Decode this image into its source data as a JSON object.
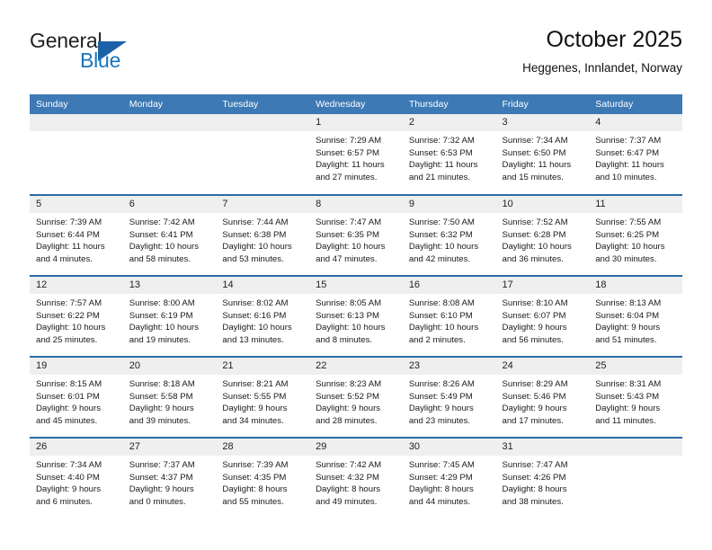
{
  "brand": {
    "name_top": "General",
    "name_bottom": "Blue",
    "color_dark": "#231f20",
    "color_blue": "#1b75bc",
    "triangle_color": "#1b61a8"
  },
  "header": {
    "title": "October 2025",
    "subtitle": "Heggenes, Innlandet, Norway"
  },
  "theme": {
    "header_blue": "#3d79b5",
    "row_divider_blue": "#2b6ca8",
    "daynum_band": "#efefef"
  },
  "weekday_headers": [
    "Sunday",
    "Monday",
    "Tuesday",
    "Wednesday",
    "Thursday",
    "Friday",
    "Saturday"
  ],
  "weeks": [
    [
      {
        "day": "",
        "sunrise": "",
        "sunset": "",
        "daylight_line1": "",
        "daylight_line2": ""
      },
      {
        "day": "",
        "sunrise": "",
        "sunset": "",
        "daylight_line1": "",
        "daylight_line2": ""
      },
      {
        "day": "",
        "sunrise": "",
        "sunset": "",
        "daylight_line1": "",
        "daylight_line2": ""
      },
      {
        "day": "1",
        "sunrise": "Sunrise: 7:29 AM",
        "sunset": "Sunset: 6:57 PM",
        "daylight_line1": "Daylight: 11 hours",
        "daylight_line2": "and 27 minutes."
      },
      {
        "day": "2",
        "sunrise": "Sunrise: 7:32 AM",
        "sunset": "Sunset: 6:53 PM",
        "daylight_line1": "Daylight: 11 hours",
        "daylight_line2": "and 21 minutes."
      },
      {
        "day": "3",
        "sunrise": "Sunrise: 7:34 AM",
        "sunset": "Sunset: 6:50 PM",
        "daylight_line1": "Daylight: 11 hours",
        "daylight_line2": "and 15 minutes."
      },
      {
        "day": "4",
        "sunrise": "Sunrise: 7:37 AM",
        "sunset": "Sunset: 6:47 PM",
        "daylight_line1": "Daylight: 11 hours",
        "daylight_line2": "and 10 minutes."
      }
    ],
    [
      {
        "day": "5",
        "sunrise": "Sunrise: 7:39 AM",
        "sunset": "Sunset: 6:44 PM",
        "daylight_line1": "Daylight: 11 hours",
        "daylight_line2": "and 4 minutes."
      },
      {
        "day": "6",
        "sunrise": "Sunrise: 7:42 AM",
        "sunset": "Sunset: 6:41 PM",
        "daylight_line1": "Daylight: 10 hours",
        "daylight_line2": "and 58 minutes."
      },
      {
        "day": "7",
        "sunrise": "Sunrise: 7:44 AM",
        "sunset": "Sunset: 6:38 PM",
        "daylight_line1": "Daylight: 10 hours",
        "daylight_line2": "and 53 minutes."
      },
      {
        "day": "8",
        "sunrise": "Sunrise: 7:47 AM",
        "sunset": "Sunset: 6:35 PM",
        "daylight_line1": "Daylight: 10 hours",
        "daylight_line2": "and 47 minutes."
      },
      {
        "day": "9",
        "sunrise": "Sunrise: 7:50 AM",
        "sunset": "Sunset: 6:32 PM",
        "daylight_line1": "Daylight: 10 hours",
        "daylight_line2": "and 42 minutes."
      },
      {
        "day": "10",
        "sunrise": "Sunrise: 7:52 AM",
        "sunset": "Sunset: 6:28 PM",
        "daylight_line1": "Daylight: 10 hours",
        "daylight_line2": "and 36 minutes."
      },
      {
        "day": "11",
        "sunrise": "Sunrise: 7:55 AM",
        "sunset": "Sunset: 6:25 PM",
        "daylight_line1": "Daylight: 10 hours",
        "daylight_line2": "and 30 minutes."
      }
    ],
    [
      {
        "day": "12",
        "sunrise": "Sunrise: 7:57 AM",
        "sunset": "Sunset: 6:22 PM",
        "daylight_line1": "Daylight: 10 hours",
        "daylight_line2": "and 25 minutes."
      },
      {
        "day": "13",
        "sunrise": "Sunrise: 8:00 AM",
        "sunset": "Sunset: 6:19 PM",
        "daylight_line1": "Daylight: 10 hours",
        "daylight_line2": "and 19 minutes."
      },
      {
        "day": "14",
        "sunrise": "Sunrise: 8:02 AM",
        "sunset": "Sunset: 6:16 PM",
        "daylight_line1": "Daylight: 10 hours",
        "daylight_line2": "and 13 minutes."
      },
      {
        "day": "15",
        "sunrise": "Sunrise: 8:05 AM",
        "sunset": "Sunset: 6:13 PM",
        "daylight_line1": "Daylight: 10 hours",
        "daylight_line2": "and 8 minutes."
      },
      {
        "day": "16",
        "sunrise": "Sunrise: 8:08 AM",
        "sunset": "Sunset: 6:10 PM",
        "daylight_line1": "Daylight: 10 hours",
        "daylight_line2": "and 2 minutes."
      },
      {
        "day": "17",
        "sunrise": "Sunrise: 8:10 AM",
        "sunset": "Sunset: 6:07 PM",
        "daylight_line1": "Daylight: 9 hours",
        "daylight_line2": "and 56 minutes."
      },
      {
        "day": "18",
        "sunrise": "Sunrise: 8:13 AM",
        "sunset": "Sunset: 6:04 PM",
        "daylight_line1": "Daylight: 9 hours",
        "daylight_line2": "and 51 minutes."
      }
    ],
    [
      {
        "day": "19",
        "sunrise": "Sunrise: 8:15 AM",
        "sunset": "Sunset: 6:01 PM",
        "daylight_line1": "Daylight: 9 hours",
        "daylight_line2": "and 45 minutes."
      },
      {
        "day": "20",
        "sunrise": "Sunrise: 8:18 AM",
        "sunset": "Sunset: 5:58 PM",
        "daylight_line1": "Daylight: 9 hours",
        "daylight_line2": "and 39 minutes."
      },
      {
        "day": "21",
        "sunrise": "Sunrise: 8:21 AM",
        "sunset": "Sunset: 5:55 PM",
        "daylight_line1": "Daylight: 9 hours",
        "daylight_line2": "and 34 minutes."
      },
      {
        "day": "22",
        "sunrise": "Sunrise: 8:23 AM",
        "sunset": "Sunset: 5:52 PM",
        "daylight_line1": "Daylight: 9 hours",
        "daylight_line2": "and 28 minutes."
      },
      {
        "day": "23",
        "sunrise": "Sunrise: 8:26 AM",
        "sunset": "Sunset: 5:49 PM",
        "daylight_line1": "Daylight: 9 hours",
        "daylight_line2": "and 23 minutes."
      },
      {
        "day": "24",
        "sunrise": "Sunrise: 8:29 AM",
        "sunset": "Sunset: 5:46 PM",
        "daylight_line1": "Daylight: 9 hours",
        "daylight_line2": "and 17 minutes."
      },
      {
        "day": "25",
        "sunrise": "Sunrise: 8:31 AM",
        "sunset": "Sunset: 5:43 PM",
        "daylight_line1": "Daylight: 9 hours",
        "daylight_line2": "and 11 minutes."
      }
    ],
    [
      {
        "day": "26",
        "sunrise": "Sunrise: 7:34 AM",
        "sunset": "Sunset: 4:40 PM",
        "daylight_line1": "Daylight: 9 hours",
        "daylight_line2": "and 6 minutes."
      },
      {
        "day": "27",
        "sunrise": "Sunrise: 7:37 AM",
        "sunset": "Sunset: 4:37 PM",
        "daylight_line1": "Daylight: 9 hours",
        "daylight_line2": "and 0 minutes."
      },
      {
        "day": "28",
        "sunrise": "Sunrise: 7:39 AM",
        "sunset": "Sunset: 4:35 PM",
        "daylight_line1": "Daylight: 8 hours",
        "daylight_line2": "and 55 minutes."
      },
      {
        "day": "29",
        "sunrise": "Sunrise: 7:42 AM",
        "sunset": "Sunset: 4:32 PM",
        "daylight_line1": "Daylight: 8 hours",
        "daylight_line2": "and 49 minutes."
      },
      {
        "day": "30",
        "sunrise": "Sunrise: 7:45 AM",
        "sunset": "Sunset: 4:29 PM",
        "daylight_line1": "Daylight: 8 hours",
        "daylight_line2": "and 44 minutes."
      },
      {
        "day": "31",
        "sunrise": "Sunrise: 7:47 AM",
        "sunset": "Sunset: 4:26 PM",
        "daylight_line1": "Daylight: 8 hours",
        "daylight_line2": "and 38 minutes."
      },
      {
        "day": "",
        "sunrise": "",
        "sunset": "",
        "daylight_line1": "",
        "daylight_line2": ""
      }
    ]
  ]
}
